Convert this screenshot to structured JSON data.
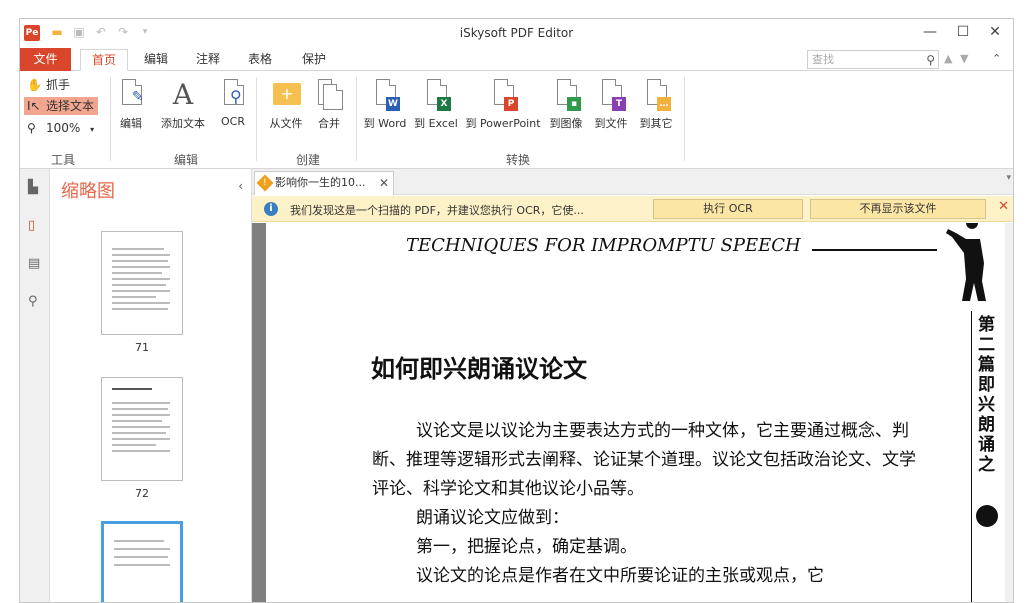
{
  "window": {
    "title": "iSkysoft PDF Editor",
    "logo": "Pe",
    "minimize": "—",
    "maximize": "☐",
    "close": "✕"
  },
  "menu": {
    "file": "文件",
    "tabs": [
      "首页",
      "编辑",
      "注释",
      "表格",
      "保护"
    ],
    "active_tab": "首页",
    "search_placeholder": "查找"
  },
  "ribbon": {
    "tools": {
      "hand": "抓手",
      "select_text": "选择文本",
      "zoom": "100%",
      "label": "工具"
    },
    "edit": {
      "buttons": [
        "编辑",
        "添加文本",
        "OCR"
      ],
      "label": "编辑"
    },
    "create": {
      "buttons": [
        "从文件",
        "合并"
      ],
      "label": "创建"
    },
    "convert": {
      "buttons": [
        "到 Word",
        "到 Excel",
        "到 PowerPoint",
        "到图像",
        "到文件",
        "到其它"
      ],
      "badges": [
        "W",
        "X",
        "P",
        "",
        "T",
        "…"
      ],
      "badge_colors": [
        "#2b5fb4",
        "#1e7a43",
        "#d9462b",
        "#2e9a4a",
        "#8a3fb0",
        "#f0b23c"
      ],
      "label": "转换"
    }
  },
  "thumbnails": {
    "title": "缩略图",
    "pages": [
      "71",
      "72",
      ""
    ]
  },
  "document": {
    "tab_name": "影响你一生的10...",
    "notice": {
      "message": "我们发现这是一个扫描的 PDF，并建议您执行 OCR，它使...",
      "ocr_button": "执行 OCR",
      "dismiss_button": "不再显示该文件"
    },
    "page": {
      "header": "TECHNIQUES FOR IMPROMPTU SPEECH",
      "side_text": "第二篇 即兴朗诵之",
      "title": "如何即兴朗诵议论文",
      "paragraphs": [
        "议论文是以议论为主要表达方式的一种文体，它主要通过概念、判断、推理等逻辑形式去阐释、论证某个道理。议论文包括政治论文、文学评论、科学论文和其他议论小品等。",
        "朗诵议论文应做到：",
        "第一，把握论点，确定基调。",
        "议论文的论点是作者在文中所要论证的主张或观点，它"
      ]
    }
  },
  "colors": {
    "accent": "#d9462b",
    "thumb_title": "#e8644a",
    "selection": "#f3a68f",
    "notice_bg": "#fdf1c8"
  }
}
